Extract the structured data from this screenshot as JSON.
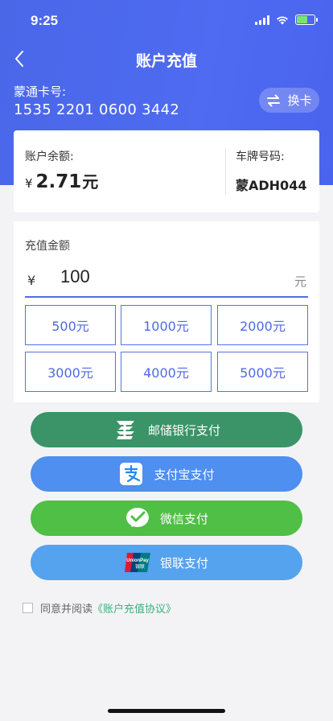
{
  "status_bar": {
    "time": "9:25"
  },
  "nav": {
    "title": "账户充值"
  },
  "card": {
    "label": "蒙通卡号:",
    "number": "1535 2201 0600 3442",
    "switch_label": "换卡"
  },
  "balance": {
    "label": "账户余额:",
    "currency": "¥",
    "amount": "2.71",
    "unit": "元",
    "plate_label": "车牌号码:",
    "plate_value": "蒙ADH044"
  },
  "recharge": {
    "label": "充值金额",
    "currency": "¥",
    "amount": "100",
    "unit": "元",
    "options": [
      "500元",
      "1000元",
      "2000元",
      "3000元",
      "4000元",
      "5000元"
    ]
  },
  "payments": [
    {
      "label": "邮储银行支付",
      "color": "#3a9468",
      "icon": "postal-savings-bank-icon"
    },
    {
      "label": "支付宝支付",
      "color": "#4e8ff0",
      "icon": "alipay-icon"
    },
    {
      "label": "微信支付",
      "color": "#4fbf45",
      "icon": "wechat-pay-icon"
    },
    {
      "label": "银联支付",
      "color": "#55a2ef",
      "icon": "unionpay-icon"
    }
  ],
  "unionpay_icon_text": {
    "top": "UnionPay",
    "bottom": "银联"
  },
  "agreement": {
    "text": "同意并阅读",
    "link": "《账户充值协议》"
  },
  "colors": {
    "header": "#4e6bf1",
    "accent": "#4f6de6",
    "link": "#3fae7b"
  }
}
